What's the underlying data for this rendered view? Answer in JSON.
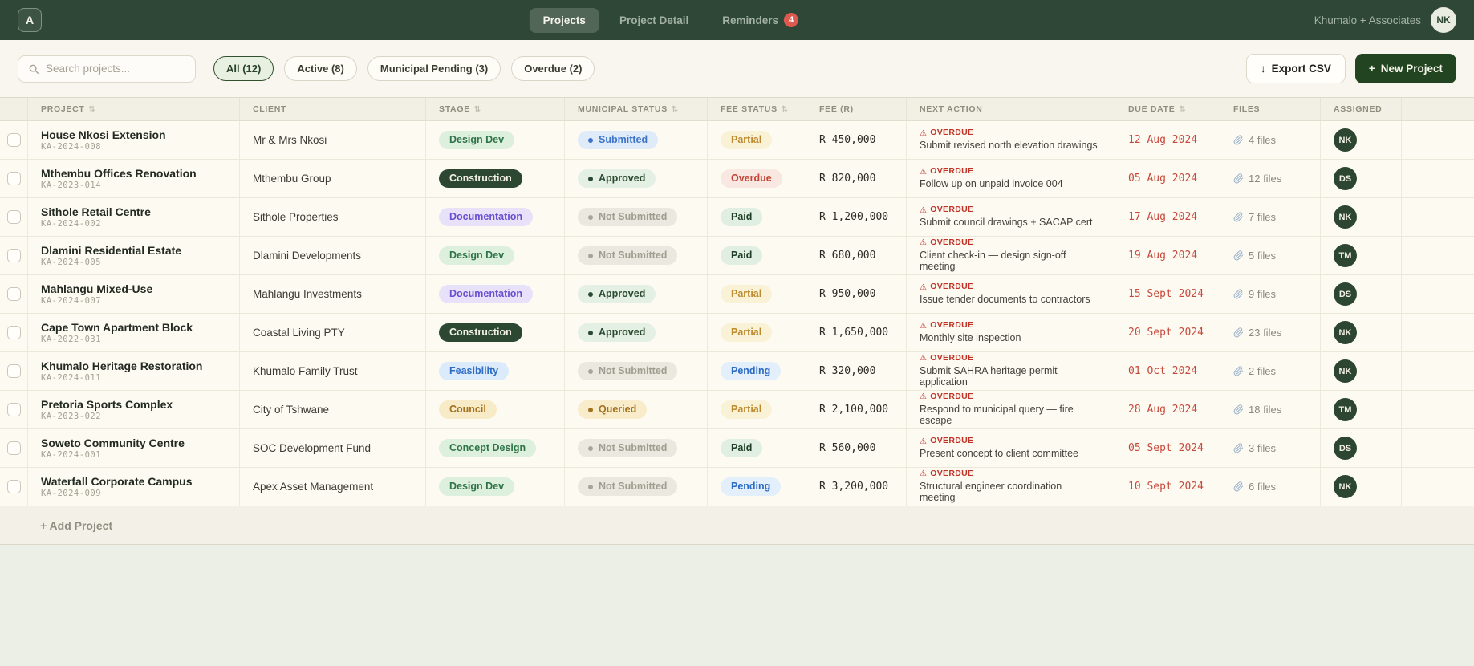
{
  "brand": {
    "logo_letter": "A",
    "org_name": "Khumalo + Associates",
    "user_initials": "NK"
  },
  "nav": {
    "tabs": [
      {
        "label": "Projects",
        "active": true
      },
      {
        "label": "Project Detail",
        "active": false
      },
      {
        "label": "Reminders",
        "active": false,
        "badge": "4"
      }
    ]
  },
  "toolbar": {
    "search_placeholder": "Search projects...",
    "filters": [
      {
        "label": "All (12)",
        "active": true
      },
      {
        "label": "Active (8)",
        "active": false
      },
      {
        "label": "Municipal Pending (3)",
        "active": false
      },
      {
        "label": "Overdue (2)",
        "active": false
      }
    ],
    "export_icon": "↓",
    "export_label": "Export CSV",
    "new_project_icon": "+",
    "new_project_label": "New Project"
  },
  "table": {
    "columns": [
      {
        "label": "",
        "sortable": false
      },
      {
        "label": "PROJECT",
        "sortable": true
      },
      {
        "label": "CLIENT",
        "sortable": false
      },
      {
        "label": "STAGE",
        "sortable": true
      },
      {
        "label": "MUNICIPAL STATUS",
        "sortable": true
      },
      {
        "label": "FEE STATUS",
        "sortable": true
      },
      {
        "label": "FEE (R)",
        "sortable": false
      },
      {
        "label": "NEXT ACTION",
        "sortable": false
      },
      {
        "label": "DUE DATE",
        "sortable": true
      },
      {
        "label": "FILES",
        "sortable": false
      },
      {
        "label": "ASSIGNED",
        "sortable": false
      },
      {
        "label": "",
        "sortable": false
      }
    ],
    "rows": [
      {
        "name": "House Nkosi Extension",
        "code": "KA-2024-008",
        "client": "Mr & Mrs Nkosi",
        "stage": "Design Dev",
        "municipal": "Submitted",
        "fee_status": "Partial",
        "fee": "R 450,000",
        "action_flag": "OVERDUE",
        "action": "Submit revised north elevation drawings",
        "due": "12 Aug 2024",
        "files": "4 files",
        "assignee": "NK"
      },
      {
        "name": "Mthembu Offices Renovation",
        "code": "KA-2023-014",
        "client": "Mthembu Group",
        "stage": "Construction",
        "municipal": "Approved",
        "fee_status": "Overdue",
        "fee": "R 820,000",
        "action_flag": "OVERDUE",
        "action": "Follow up on unpaid invoice 004",
        "due": "05 Aug 2024",
        "files": "12 files",
        "assignee": "DS"
      },
      {
        "name": "Sithole Retail Centre",
        "code": "KA-2024-002",
        "client": "Sithole Properties",
        "stage": "Documentation",
        "municipal": "Not Submitted",
        "fee_status": "Paid",
        "fee": "R 1,200,000",
        "action_flag": "OVERDUE",
        "action": "Submit council drawings + SACAP cert",
        "due": "17 Aug 2024",
        "files": "7 files",
        "assignee": "NK"
      },
      {
        "name": "Dlamini Residential Estate",
        "code": "KA-2024-005",
        "client": "Dlamini Developments",
        "stage": "Design Dev",
        "municipal": "Not Submitted",
        "fee_status": "Paid",
        "fee": "R 680,000",
        "action_flag": "OVERDUE",
        "action": "Client check-in — design sign-off meeting",
        "due": "19 Aug 2024",
        "files": "5 files",
        "assignee": "TM"
      },
      {
        "name": "Mahlangu Mixed-Use",
        "code": "KA-2024-007",
        "client": "Mahlangu Investments",
        "stage": "Documentation",
        "municipal": "Approved",
        "fee_status": "Partial",
        "fee": "R 950,000",
        "action_flag": "OVERDUE",
        "action": "Issue tender documents to contractors",
        "due": "15 Sept 2024",
        "files": "9 files",
        "assignee": "DS"
      },
      {
        "name": "Cape Town Apartment Block",
        "code": "KA-2022-031",
        "client": "Coastal Living PTY",
        "stage": "Construction",
        "municipal": "Approved",
        "fee_status": "Partial",
        "fee": "R 1,650,000",
        "action_flag": "OVERDUE",
        "action": "Monthly site inspection",
        "due": "20 Sept 2024",
        "files": "23 files",
        "assignee": "NK"
      },
      {
        "name": "Khumalo Heritage Restoration",
        "code": "KA-2024-011",
        "client": "Khumalo Family Trust",
        "stage": "Feasibility",
        "municipal": "Not Submitted",
        "fee_status": "Pending",
        "fee": "R 320,000",
        "action_flag": "OVERDUE",
        "action": "Submit SAHRA heritage permit application",
        "due": "01 Oct 2024",
        "files": "2 files",
        "assignee": "NK"
      },
      {
        "name": "Pretoria Sports Complex",
        "code": "KA-2023-022",
        "client": "City of Tshwane",
        "stage": "Council",
        "municipal": "Queried",
        "fee_status": "Partial",
        "fee": "R 2,100,000",
        "action_flag": "OVERDUE",
        "action": "Respond to municipal query — fire escape",
        "due": "28 Aug 2024",
        "files": "18 files",
        "assignee": "TM"
      },
      {
        "name": "Soweto Community Centre",
        "code": "KA-2024-001",
        "client": "SOC Development Fund",
        "stage": "Concept Design",
        "municipal": "Not Submitted",
        "fee_status": "Paid",
        "fee": "R 560,000",
        "action_flag": "OVERDUE",
        "action": "Present concept to client committee",
        "due": "05 Sept 2024",
        "files": "3 files",
        "assignee": "DS"
      },
      {
        "name": "Waterfall Corporate Campus",
        "code": "KA-2024-009",
        "client": "Apex Asset Management",
        "stage": "Design Dev",
        "municipal": "Not Submitted",
        "fee_status": "Pending",
        "fee": "R 3,200,000",
        "action_flag": "OVERDUE",
        "action": "Structural engineer coordination meeting",
        "due": "10 Sept 2024",
        "files": "6 files",
        "assignee": "NK"
      }
    ],
    "footer_label": "+ Add Project"
  },
  "styles": {
    "stage": {
      "Design Dev": "green",
      "Concept Design": "green",
      "Construction": "dark",
      "Documentation": "purple",
      "Feasibility": "blue",
      "Council": "amber"
    },
    "municipal": {
      "Submitted": "blue",
      "Approved": "green",
      "Not Submitted": "gray",
      "Queried": "amber"
    },
    "fee": {
      "Partial": "amber",
      "Overdue": "red",
      "Paid": "green",
      "Pending": "blue"
    }
  },
  "colors": {
    "topbar": "#2f4736",
    "toolbar_bg": "#f8f6ee",
    "row_bg": "#fdfaf2",
    "header_bg": "#f2f0e5",
    "primary_button": "#224420",
    "overdue_red": "#c13327",
    "badge_dark_green": "#2c4732",
    "reminder_badge": "#dd5a50",
    "avatar_green": "#2c4631"
  }
}
